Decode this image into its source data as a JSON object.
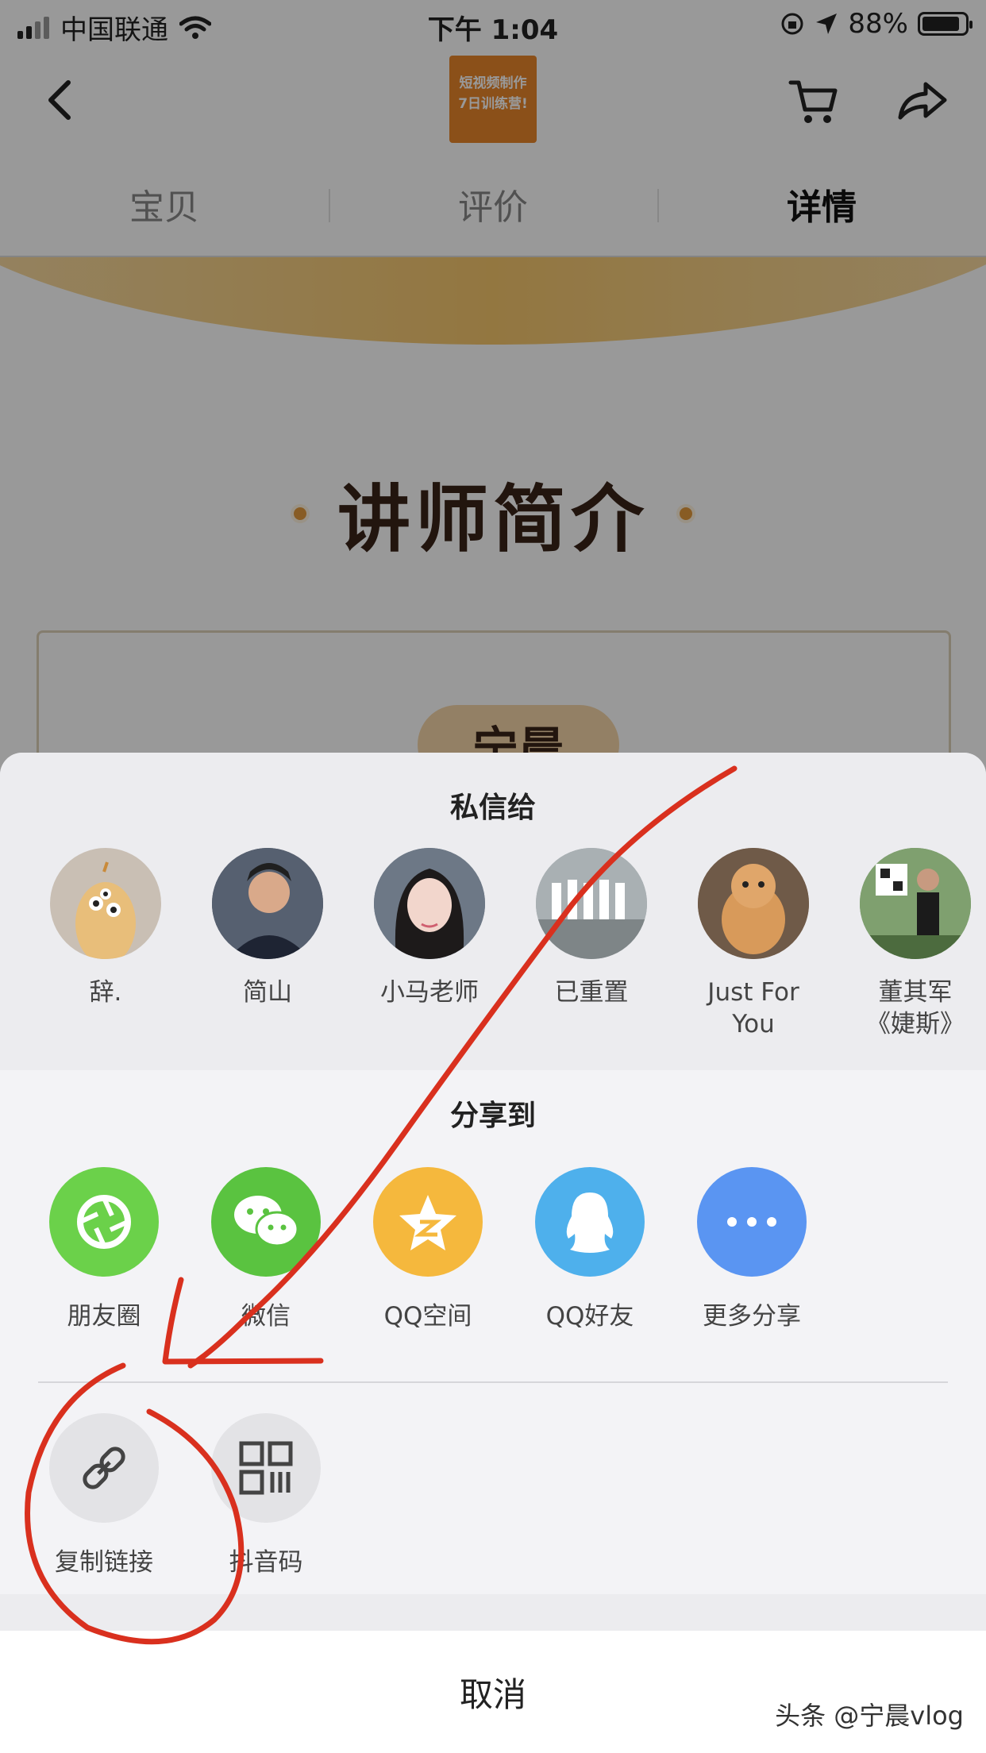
{
  "status_bar": {
    "carrier": "中国联通",
    "time": "下午 1:04",
    "battery": "88%"
  },
  "nav": {
    "thumb_text_line1": "短视频制作",
    "thumb_text_line2": "7日训练营!"
  },
  "tabs": [
    {
      "label": "宝贝"
    },
    {
      "label": "评价"
    },
    {
      "label": "详情",
      "active": true
    }
  ],
  "content": {
    "section_title": "讲师简介",
    "teacher_name": "宁晨"
  },
  "share_sheet": {
    "dm_title": "私信给",
    "contacts": [
      {
        "name": "辞."
      },
      {
        "name": "简山"
      },
      {
        "name": "小马老师"
      },
      {
        "name": "已重置"
      },
      {
        "name_line1": "Just For",
        "name_line2": "You"
      },
      {
        "name_line1": "董其军",
        "name_line2": "《婕斯》"
      }
    ],
    "share_title": "分享到",
    "share_targets": [
      {
        "label": "朋友圈",
        "color": "#6bd14a"
      },
      {
        "label": "微信",
        "color": "#5ac340"
      },
      {
        "label": "QQ空间",
        "color": "#f5b83d"
      },
      {
        "label": "QQ好友",
        "color": "#4eb0ec"
      },
      {
        "label": "更多分享",
        "color": "#5a95f2"
      }
    ],
    "utilities": [
      {
        "label": "复制链接"
      },
      {
        "label": "抖音码"
      }
    ],
    "cancel_label": "取消"
  },
  "annotation": {
    "stroke_color": "#d9301e"
  },
  "watermark": "头条 @宁晨vlog"
}
